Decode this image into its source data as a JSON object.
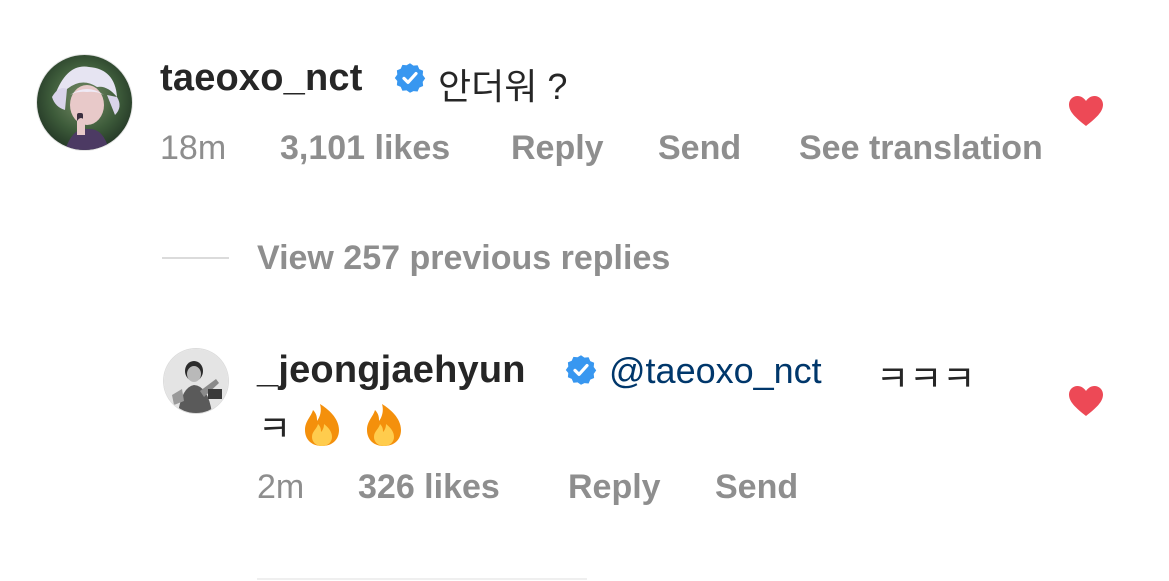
{
  "comment": {
    "username": "taeoxo_nct",
    "text": "안더워 ?",
    "time": "18m",
    "likes": "3,101 likes",
    "reply_label": "Reply",
    "send_label": "Send",
    "translation_label": "See translation"
  },
  "view_replies": {
    "label": "View 257 previous replies"
  },
  "reply": {
    "username": "_jeongjaehyun",
    "mention": "@taeoxo_nct",
    "text_line1": "ㅋㅋㅋ",
    "text_line2": "ㅋ",
    "time": "2m",
    "likes": "326 likes",
    "reply_label": "Reply",
    "send_label": "Send"
  },
  "colors": {
    "verified": "#3897f0",
    "heart": "#ed4956",
    "meta": "#8e8e8e",
    "mention": "#00376b"
  },
  "icons": [
    "verified-badge-icon",
    "heart-icon",
    "fire-emoji-icon"
  ]
}
